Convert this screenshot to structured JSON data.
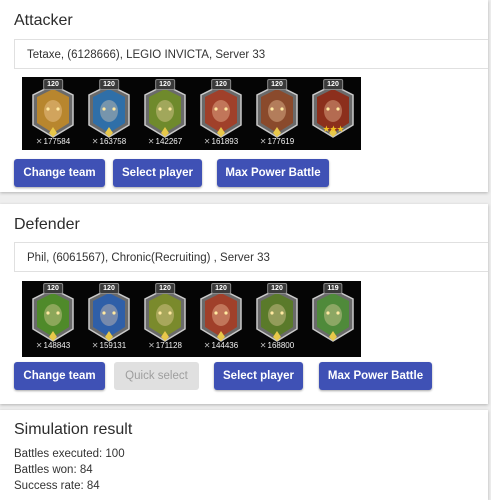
{
  "attacker": {
    "title": "Attacker",
    "player": "Tetaxe, (6128666), LEGIO INVICTA, Server 33",
    "heroes": [
      {
        "level": "120",
        "power": "177584",
        "icon": "hero-portrait-icon",
        "color": "#b8862e"
      },
      {
        "level": "120",
        "power": "163758",
        "icon": "hero-portrait-icon",
        "color": "#2f6fa8"
      },
      {
        "level": "120",
        "power": "142267",
        "icon": "hero-portrait-icon",
        "color": "#6f8a2c"
      },
      {
        "level": "120",
        "power": "161893",
        "icon": "hero-portrait-icon",
        "color": "#a0402a"
      },
      {
        "level": "120",
        "power": "177619",
        "icon": "hero-portrait-icon",
        "color": "#8a4a2c"
      },
      {
        "level": "120",
        "power": "",
        "stars": "★★★",
        "icon": "pet-portrait-icon",
        "color": "#8c2f1c"
      }
    ],
    "buttons": {
      "change_team": "Change team",
      "select_player": "Select player",
      "max_power": "Max Power Battle"
    }
  },
  "defender": {
    "title": "Defender",
    "player": "Phil, (6061567), Chronic(Recruiting) , Server 33",
    "heroes": [
      {
        "level": "120",
        "power": "148843",
        "icon": "hero-portrait-icon",
        "color": "#4f8a2a"
      },
      {
        "level": "120",
        "power": "159131",
        "icon": "hero-portrait-icon",
        "color": "#2f5fa8"
      },
      {
        "level": "120",
        "power": "171128",
        "icon": "hero-portrait-icon",
        "color": "#7a8a2c"
      },
      {
        "level": "120",
        "power": "144436",
        "icon": "hero-portrait-icon",
        "color": "#a0402a"
      },
      {
        "level": "120",
        "power": "168800",
        "icon": "hero-portrait-icon",
        "color": "#5a7a2a"
      },
      {
        "level": "119",
        "power": "",
        "icon": "pet-portrait-icon",
        "color": "#4f8a3a"
      }
    ],
    "buttons": {
      "change_team": "Change team",
      "quick_select": "Quick select",
      "select_player": "Select player",
      "max_power": "Max Power Battle"
    }
  },
  "result": {
    "title": "Simulation result",
    "lines": [
      "Battles executed: 100",
      "Battles won: 84",
      "Success rate: 84"
    ]
  },
  "colors": {
    "accent": "#3f51b5",
    "disabled": "#e0e0e0",
    "strip_bg": "#050505"
  }
}
